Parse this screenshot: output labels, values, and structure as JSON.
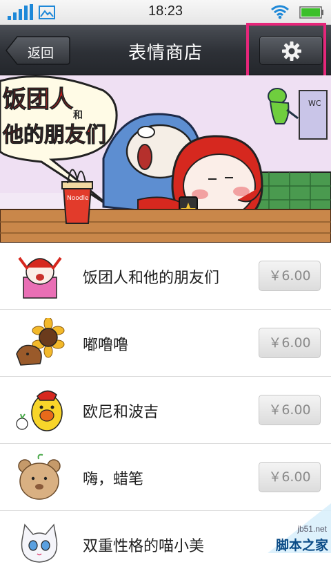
{
  "status_bar": {
    "time": "18:23"
  },
  "header": {
    "back_label": "返回",
    "title": "表情商店"
  },
  "banner": {
    "headline_line1": "饭团人",
    "headline_mid": "和",
    "headline_line2": "他的朋友们",
    "noodle_label": "Noodle",
    "door_label": "WC"
  },
  "items": [
    {
      "name": "饭团人和他的朋友们",
      "price": "￥6.00"
    },
    {
      "name": "嘟噜噜",
      "price": "￥6.00"
    },
    {
      "name": "欧尼和波吉",
      "price": "￥6.00"
    },
    {
      "name": "嗨，蜡笔",
      "price": "￥6.00"
    },
    {
      "name": "双重性格的喵小美",
      "price": ""
    }
  ],
  "watermark": {
    "url": "jb51.net",
    "text": "脚本之家"
  },
  "colors": {
    "title_bar": "#2d3036",
    "highlight": "#e6267a",
    "signal_blue": "#1e88d8",
    "battery_green": "#3cbf2a"
  }
}
